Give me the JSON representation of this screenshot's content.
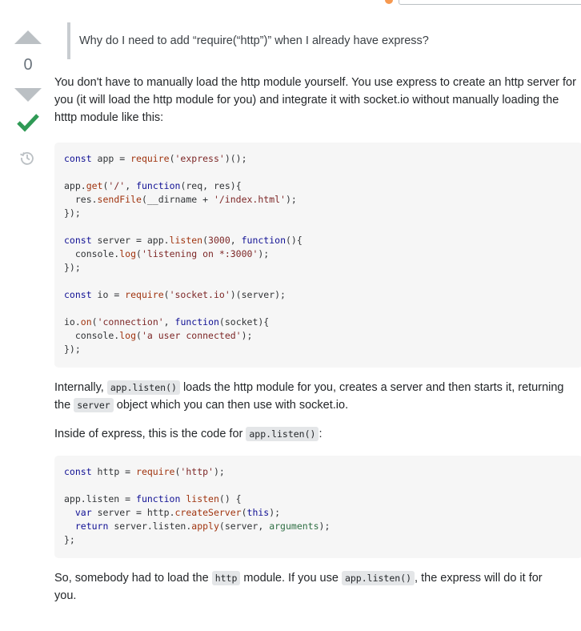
{
  "question_quote": "Why do I need to add “require(“http”)” when I already have express?",
  "vote_count": "0",
  "icons": {
    "upvote": "upvote-arrow-icon",
    "downvote": "downvote-arrow-icon",
    "accepted": "accepted-checkmark-icon",
    "history": "history-clock-icon"
  },
  "colors": {
    "accepted": "#2f9a55",
    "vote_arrow": "#bbc0c4",
    "code_bg": "#f6f6f6"
  },
  "answer": {
    "para1": "You don't have to manually load the http module yourself. You use express to create an http server for you (it will load the http module for you) and integrate it with socket.io without manually loading the htttp module like this:",
    "code1": {
      "l1": [
        "const",
        " app = ",
        "require",
        "(",
        "'express'",
        ")();"
      ],
      "l2": [
        "app.",
        "get",
        "(",
        "'/'",
        ", ",
        "function",
        "(req, res){"
      ],
      "l3": [
        "  res.",
        "sendFile",
        "(__dirname + ",
        "'/index.html'",
        ");"
      ],
      "l4": "});",
      "l5": [
        "const",
        " server = app.",
        "listen",
        "(",
        "3000",
        ", ",
        "function",
        "(){"
      ],
      "l6": [
        "  console.",
        "log",
        "(",
        "'listening on *:3000'",
        ");"
      ],
      "l7": "});",
      "l8": [
        "const",
        " io = ",
        "require",
        "(",
        "'socket.io'",
        ")(server);"
      ],
      "l9": [
        "io.",
        "on",
        "(",
        "'connection'",
        ", ",
        "function",
        "(socket){"
      ],
      "l10": [
        "  console.",
        "log",
        "(",
        "'a user connected'",
        ");"
      ],
      "l11": "});"
    },
    "para2_a": "Internally, ",
    "para2_code1": "app.listen()",
    "para2_b": " loads the http module for you, creates a server and then starts it, returning the ",
    "para2_code2": "server",
    "para2_c": " object which you can then use with socket.io.",
    "para3_a": "Inside of express, this is the code for ",
    "para3_code": "app.listen()",
    "para3_b": ":",
    "code2": {
      "l1": [
        "const",
        " http = ",
        "require",
        "(",
        "'http'",
        ");"
      ],
      "l2": [
        "app.listen = ",
        "function",
        " ",
        "listen",
        "() {"
      ],
      "l3": [
        "  ",
        "var",
        " server = http.",
        "createServer",
        "(",
        "this",
        ");"
      ],
      "l4": [
        "  ",
        "return",
        " server.listen.",
        "apply",
        "(server, ",
        "arguments",
        ");"
      ],
      "l5": "};"
    },
    "para4_a": "So, somebody had to load the ",
    "para4_code1": "http",
    "para4_b": " module. If you use ",
    "para4_code2": "app.listen()",
    "para4_c": ", the express will do it for you."
  }
}
